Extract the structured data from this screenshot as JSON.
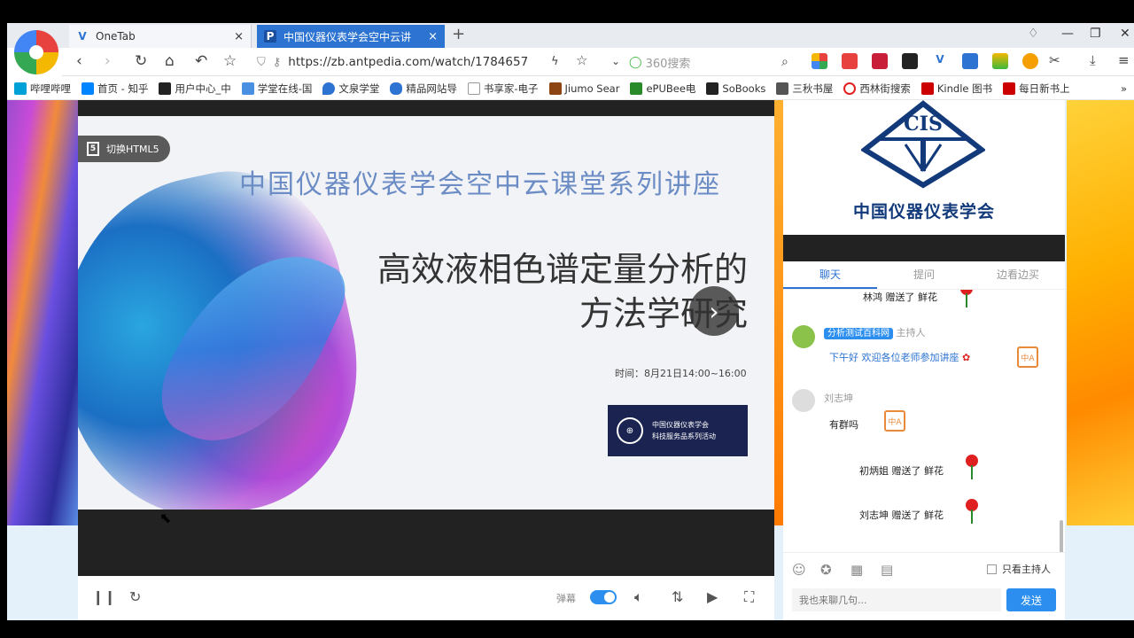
{
  "tabs": [
    {
      "icon": "V",
      "title": "OneTab",
      "close": "×"
    },
    {
      "icon": "P",
      "title": "中国仪器仪表学会空中云讲",
      "close": "×"
    }
  ],
  "new_tab": "+",
  "address": {
    "url": "https://zb.antpedia.com/watch/1784657"
  },
  "search": {
    "placeholder": "360搜索"
  },
  "bookmarks": [
    {
      "label": "哔哩哔哩",
      "color": "#00a1d6"
    },
    {
      "label": "首页 - 知乎",
      "color": "#0084ff"
    },
    {
      "label": "用户中心_中",
      "color": "#222"
    },
    {
      "label": "学堂在线-国",
      "color": "#4a90e2"
    },
    {
      "label": "文泉学堂",
      "color": "#2c73d2"
    },
    {
      "label": "精品网站导",
      "color": "#2c73d2"
    },
    {
      "label": "书享家-电子",
      "color": "#bbb"
    },
    {
      "label": "Jiumo Sear",
      "color": "#8b4513"
    },
    {
      "label": "ePUBee电",
      "color": "#2a8a2a"
    },
    {
      "label": "SoBooks",
      "color": "#222"
    },
    {
      "label": "三秋书屋",
      "color": "#555"
    },
    {
      "label": "西林街搜索",
      "color": "#e02020"
    },
    {
      "label": "Kindle 图书",
      "color": "#c00"
    },
    {
      "label": "每日新书上",
      "color": "#c00"
    }
  ],
  "player": {
    "html5_label": "切换HTML5",
    "html5_badge": "5",
    "series_title": "中国仪器仪表学会空中云课堂系列讲座",
    "title_line1": "高效液相色谱定量分析的",
    "title_line2": "方法学研究",
    "time": "时间：8月21日14:00~16:00",
    "logo_line1": "中国仪器仪表学会",
    "logo_line2": "科技服务品系列活动",
    "danmu_label": "弹幕"
  },
  "panel": {
    "org_abbr": "CIS",
    "org_name": "中国仪器仪表学会",
    "chat_tabs": [
      "聊天",
      "提问",
      "边看边买"
    ],
    "messages": {
      "m0": "林鸿 赠送了 鲜花",
      "host_badge": "分析测试百科网",
      "host_role": "主持人",
      "host_msg": "下午好   欢迎各位老师参加讲座",
      "user2_name": "刘志坤",
      "user2_msg": "有群吗",
      "gift1": "初炳姐 赠送了 鲜花",
      "gift2": "刘志坤 赠送了 鲜花"
    },
    "only_host": "只看主持人",
    "input_placeholder": "我也来聊几句...",
    "send_label": "发送"
  }
}
